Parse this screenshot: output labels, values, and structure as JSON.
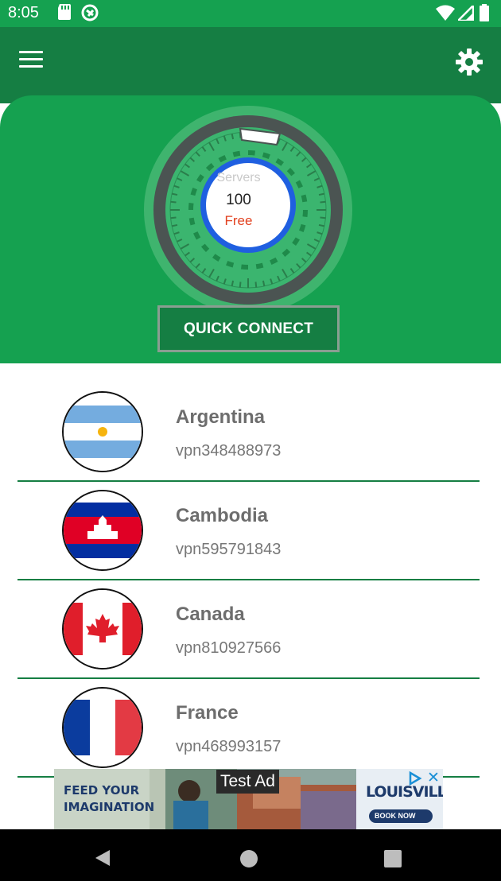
{
  "status_bar": {
    "time": "8:05",
    "left_icons": [
      "sd-card-icon",
      "vpn-status-icon"
    ],
    "right_icons": [
      "wifi-icon",
      "cell-signal-icon",
      "battery-icon"
    ]
  },
  "toolbar": {
    "menu_icon": "hamburger-menu-icon",
    "settings_icon": "gear-icon"
  },
  "dashboard": {
    "servers_label": "Servers",
    "servers_count": "100",
    "servers_status": "Free",
    "quick_connect_label": "QUICK CONNECT"
  },
  "servers": [
    {
      "country": "Argentina",
      "server_id": "vpn348488973",
      "flag_icon": "argentina-flag-icon"
    },
    {
      "country": "Cambodia",
      "server_id": "vpn595791843",
      "flag_icon": "cambodia-flag-icon"
    },
    {
      "country": "Canada",
      "server_id": "vpn810927566",
      "flag_icon": "canada-flag-icon"
    },
    {
      "country": "France",
      "server_id": "vpn468993157",
      "flag_icon": "france-flag-icon"
    }
  ],
  "ad": {
    "label": "Test Ad",
    "left_text": "FEED YOUR IMAGINATION",
    "brand": "LOUISVILLE",
    "cta": "BOOK NOW"
  },
  "nav_bar": {
    "buttons": [
      "back-button",
      "home-button",
      "recents-button"
    ]
  },
  "colors": {
    "primary": "#157e43",
    "accent": "#15a150",
    "free_text": "#e2401f",
    "ring_blue": "#1f5fe0"
  }
}
